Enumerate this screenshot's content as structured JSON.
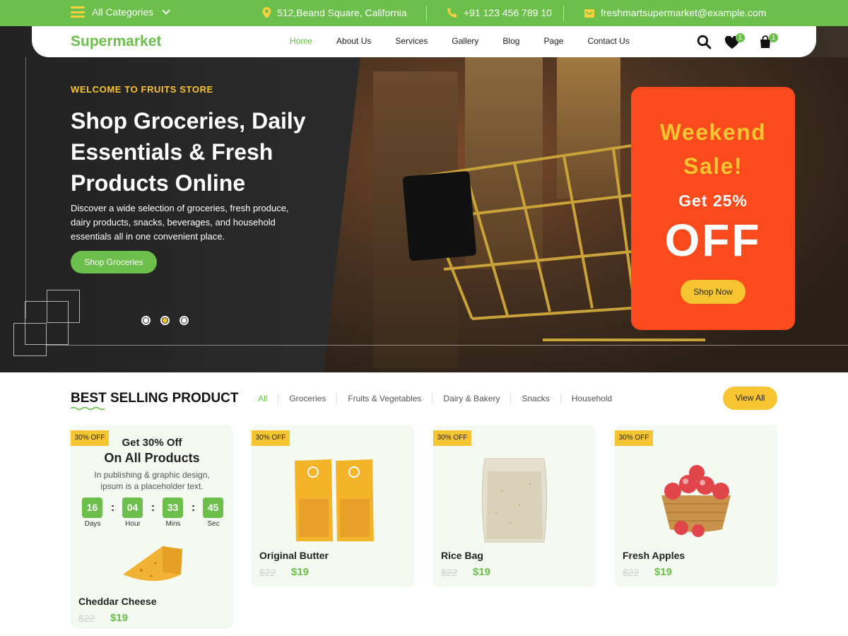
{
  "topbar": {
    "categories_label": "All Categories",
    "address": "512,Beand Square, California",
    "phone": "+91 123 456 789 10",
    "email": "freshmartsupermarket@example.com"
  },
  "nav": {
    "logo": "Supermarket",
    "items": [
      "Home",
      "About Us",
      "Services",
      "Gallery",
      "Blog",
      "Page",
      "Contact Us"
    ],
    "wishlist_count": "1",
    "cart_count": "1"
  },
  "hero": {
    "eyebrow": "WELCOME TO FRUITS STORE",
    "headline": "Shop Groceries, Daily Essentials & Fresh Products Online",
    "description": "Discover a wide selection of groceries, fresh produce, dairy products, snacks, beverages, and household essentials all in one convenient place.",
    "cta": "Shop Groceries",
    "slides": 3,
    "active_slide": 2
  },
  "sale": {
    "title": "Weekend Sale!",
    "subtitle": "Get 25%",
    "big": "OFF",
    "cta": "Shop Now"
  },
  "best_selling": {
    "title": "BEST SELLING PRODUCT",
    "filters": [
      "All",
      "Groceries",
      "Fruits & Vegetables",
      "Dairy & Bakery",
      "Snacks",
      "Household"
    ],
    "view_all": "View All"
  },
  "promo": {
    "tag": "30% OFF",
    "line1": "Get 30% Off",
    "line2": "On All Products",
    "line3": "In publishing & graphic design, ipsum is a placeholder text.",
    "days": "16",
    "days_label": "Days",
    "hours": "04",
    "hours_label": "Hour",
    "mins": "33",
    "mins_label": "Mins",
    "secs": "45",
    "secs_label": "Sec",
    "product": {
      "name": "Cheddar Cheese",
      "old_price": "$22",
      "price": "$19"
    }
  },
  "products": [
    {
      "tag": "30% OFF",
      "name": "Original Butter",
      "old_price": "$22",
      "price": "$19"
    },
    {
      "tag": "30% OFF",
      "name": "Rice Bag",
      "old_price": "$22",
      "price": "$19"
    },
    {
      "tag": "30% OFF",
      "name": "Fresh Apples",
      "old_price": "$22",
      "price": "$19"
    }
  ],
  "colors": {
    "brand_green": "#6bbf4a",
    "accent_yellow": "#f7c531",
    "sale_orange": "#fb4a1c"
  }
}
